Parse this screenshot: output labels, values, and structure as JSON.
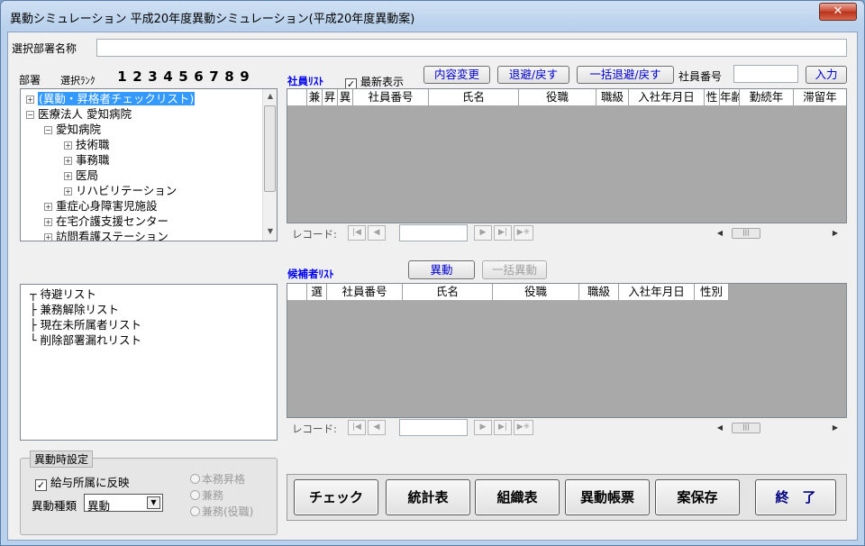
{
  "window": {
    "title": "異動シミュレーション  平成20年度異動シミュレーション(平成20年度異動案)",
    "close_glyph": "✕"
  },
  "dept_name": {
    "label": "選択部署名称",
    "value": ""
  },
  "tree_header": {
    "dept_label": "部署",
    "rank_label": "選択ﾗﾝｸ",
    "ranks": [
      "1",
      "2",
      "3",
      "4",
      "5",
      "6",
      "7",
      "8",
      "9"
    ]
  },
  "tree": {
    "items": [
      {
        "text": "(異動・昇格者チェックリスト)",
        "expander": "+"
      },
      {
        "text": "医療法人 愛知病院",
        "expander": "−"
      },
      {
        "text": "愛知病院",
        "expander": "−"
      },
      {
        "text": "技術職",
        "expander": "+"
      },
      {
        "text": "事務職",
        "expander": "+"
      },
      {
        "text": "医局",
        "expander": "+"
      },
      {
        "text": "リハビリテーション",
        "expander": "+"
      },
      {
        "text": "重症心身障害児施設",
        "expander": "+"
      },
      {
        "text": "在宅介護支援センター",
        "expander": "+"
      },
      {
        "text": "訪問看護ステーション",
        "expander": "+"
      }
    ]
  },
  "employee_list": {
    "title": "社員ﾘｽﾄ",
    "latest_display": {
      "label": "最新表示",
      "checked": true
    },
    "buttons": {
      "content_change": "内容変更",
      "evacuate_return": "退避/戻す",
      "bulk_evacuate_return": "一括退避/戻す",
      "input": "入力"
    },
    "emp_no_label": "社員番号",
    "emp_no_value": "",
    "columns": [
      "兼",
      "昇",
      "異",
      "社員番号",
      "氏名",
      "役職",
      "職級",
      "入社年月日",
      "性",
      "年齢",
      "勤続年",
      "滞留年"
    ],
    "record_label": "レコード:"
  },
  "candidate_list": {
    "title": "候補者ﾘｽﾄ",
    "buttons": {
      "transfer": "異動",
      "bulk_transfer": "一括異動"
    },
    "columns": [
      "選",
      "社員番号",
      "氏名",
      "役職",
      "職級",
      "入社年月日",
      "性別"
    ],
    "record_label": "レコード:"
  },
  "special_lists": {
    "items": [
      "待避リスト",
      "兼務解除リスト",
      "現在未所属者リスト",
      "削除部署漏れリスト"
    ]
  },
  "transfer_settings": {
    "title": "異動時設定",
    "reflect_salary": {
      "label": "給与所属に反映",
      "checked": true
    },
    "type_label": "異動種類",
    "type_value": "異動",
    "radios": [
      "本務昇格",
      "兼務",
      "兼務(役職)"
    ]
  },
  "actions": {
    "check": "チェック",
    "stats": "統計表",
    "org_chart": "組織表",
    "transfer_report": "異動帳票",
    "save_draft": "案保存",
    "exit": "終　了"
  },
  "glyphs": {
    "check": "✓",
    "first": "|◀",
    "prev": "◀",
    "next": "▶",
    "last": "▶|",
    "new": "▶✳",
    "up": "▲",
    "down": "▼",
    "left": "◀",
    "right": "▶",
    "grip": "|||",
    "dropdown": "▼"
  }
}
